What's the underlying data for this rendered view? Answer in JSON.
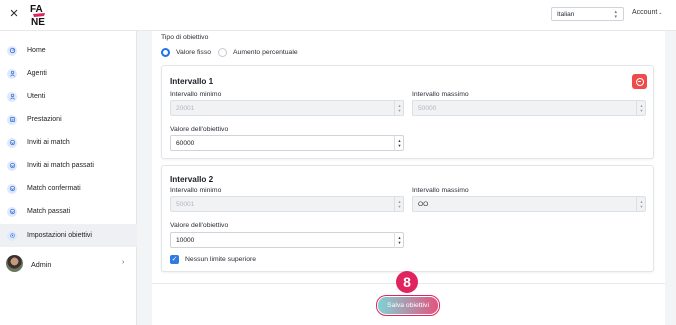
{
  "topbar": {
    "logo_text": "FA NE",
    "language_selected": "Italian",
    "account_label": "Account"
  },
  "sidebar": {
    "items": [
      {
        "label": "Home",
        "icon": "dashboard-icon"
      },
      {
        "label": "Agenti",
        "icon": "person-icon"
      },
      {
        "label": "Utenti",
        "icon": "person-icon"
      },
      {
        "label": "Prestazioni",
        "icon": "list-icon"
      },
      {
        "label": "Inviti ai match",
        "icon": "handshake-icon"
      },
      {
        "label": "Inviti ai match passati",
        "icon": "handshake-icon"
      },
      {
        "label": "Match confermati",
        "icon": "handshake-icon"
      },
      {
        "label": "Match passati",
        "icon": "handshake-icon"
      },
      {
        "label": "Impostazioni obiettivi",
        "icon": "gear-icon",
        "active": true
      }
    ],
    "user": {
      "label": "Admin"
    }
  },
  "form": {
    "goal_type_label": "Tipo di obiettivo",
    "options": [
      {
        "label": "Valore fisso",
        "checked": true
      },
      {
        "label": "Aumento percentuale",
        "checked": false
      }
    ],
    "intervals": [
      {
        "title": "Intervallo 1",
        "min_label": "Intervallo minimo",
        "min_value": "20001",
        "max_label": "Intervallo massimo",
        "max_value": "50000",
        "goal_label": "Valore dell'obiettivo",
        "goal_value": "60000"
      },
      {
        "title": "Intervallo 2",
        "min_label": "Intervallo minimo",
        "min_value": "50001",
        "max_label": "Intervallo massimo",
        "max_value": "OO",
        "goal_label": "Valore dell'obiettivo",
        "goal_value": "10000",
        "no_upper_limit_label": "Nessun limite superiore",
        "no_upper_limit_checked": true
      }
    ],
    "save_label": "Salva obiettivi"
  },
  "annotation": {
    "step_number": "8"
  },
  "colors": {
    "accent_blue": "#1f73e8",
    "danger": "#ef4b4b",
    "highlight": "#e0245e"
  }
}
